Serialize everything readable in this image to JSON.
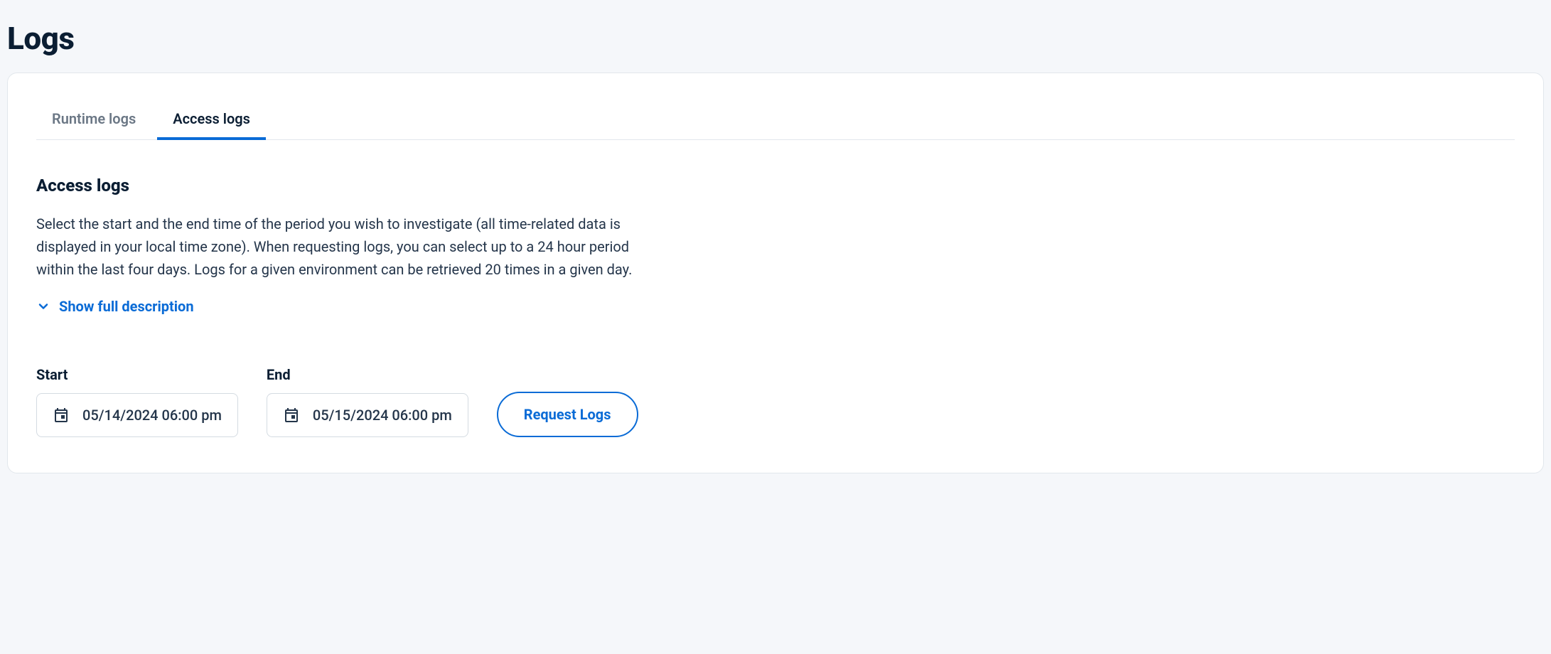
{
  "page": {
    "title": "Logs"
  },
  "tabs": [
    {
      "id": "runtime",
      "label": "Runtime logs",
      "active": false
    },
    {
      "id": "access",
      "label": "Access logs",
      "active": true
    }
  ],
  "section": {
    "title": "Access logs",
    "description": "Select the start and the end time of the period you wish to investigate (all time-related data is displayed in your local time zone). When requesting logs, you can select up to a 24 hour period within the last four days. Logs for a given environment can be retrieved 20 times in a given day.",
    "expand_label": "Show full description"
  },
  "form": {
    "start": {
      "label": "Start",
      "value": "05/14/2024 06:00 pm"
    },
    "end": {
      "label": "End",
      "value": "05/15/2024 06:00 pm"
    },
    "request_button": "Request Logs"
  }
}
